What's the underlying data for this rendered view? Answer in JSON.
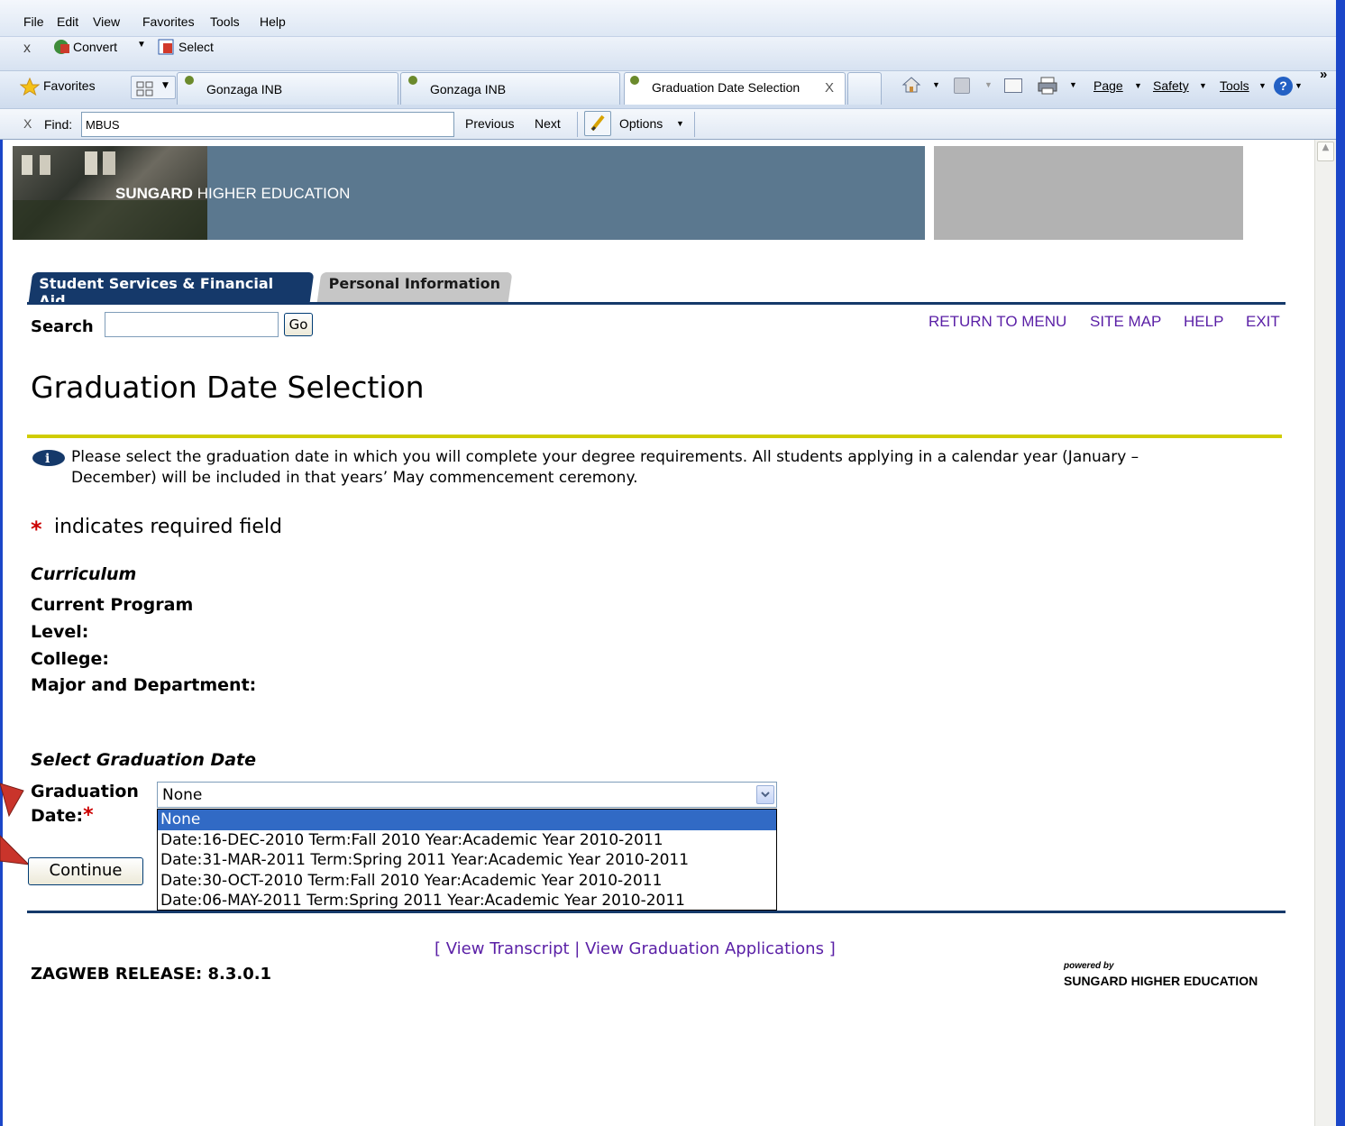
{
  "browser": {
    "menu": [
      "File",
      "Edit",
      "View",
      "Favorites",
      "Tools",
      "Help"
    ],
    "toolbar": {
      "close": "x",
      "convert_label": "Convert",
      "select_label": "Select"
    },
    "favorites_label": "Favorites",
    "tabs": [
      {
        "label": "Gonzaga INB"
      },
      {
        "label": "Gonzaga INB"
      },
      {
        "label": "Graduation Date Selection",
        "close": "X"
      }
    ],
    "right_toolbar": {
      "page": "Page",
      "safety": "Safety",
      "tools": "Tools",
      "overflow": "»"
    },
    "find": {
      "close": "X",
      "label": "Find:",
      "value": "MBUS",
      "previous": "Previous",
      "next": "Next",
      "options": "Options"
    }
  },
  "banner": {
    "brand_bold": "SUNGARD",
    "brand_rest": "HIGHER EDUCATION"
  },
  "nav": {
    "tabs": [
      "Student Services & Financial Aid",
      "Personal Information"
    ],
    "search_label": "Search",
    "search_value": "",
    "go_label": "Go",
    "links": [
      "RETURN TO MENU",
      "SITE MAP",
      "HELP",
      "EXIT"
    ]
  },
  "page": {
    "title": "Graduation Date Selection",
    "info_text_line1": "Please select the graduation date in which you will complete your degree requirements. All students applying in a calendar year (January –",
    "info_text_line2": "December) will be included in that years’ May commencement ceremony.",
    "required_star": "*",
    "required_note": "indicates required field",
    "curriculum_heading": "Curriculum",
    "curriculum_fields": [
      "Current Program",
      "Level:",
      "College:",
      "Major and Department:"
    ],
    "select_heading": "Select Graduation Date",
    "graduation_label_line1": "Graduation",
    "graduation_label_line2": "Date:",
    "dropdown_value": "None",
    "dropdown_options": [
      "None",
      "Date:16-DEC-2010 Term:Fall 2010 Year:Academic Year 2010-2011",
      "Date:31-MAR-2011 Term:Spring 2011 Year:Academic Year 2010-2011",
      "Date:30-OCT-2010 Term:Fall 2010 Year:Academic Year 2010-2011",
      "Date:06-MAY-2011 Term:Spring 2011 Year:Academic Year 2010-2011"
    ],
    "continue_label": "Continue"
  },
  "footer": {
    "bracket_open": "[",
    "link_transcript": "View Transcript",
    "separator": "|",
    "link_applications": "View Graduation Applications",
    "bracket_close": "]",
    "release": "ZAGWEB RELEASE: 8.3.0.1",
    "powered_by": "powered by",
    "powered_brand_bold": "SUNGARD",
    "powered_brand_rest": "HIGHER EDUCATION"
  },
  "colors": {
    "nav_blue": "#15396a",
    "accent_yellow": "#d0cc00",
    "link_purple": "#5a1fa6",
    "required_red": "#cc0000",
    "selected_option": "#316ac5"
  }
}
